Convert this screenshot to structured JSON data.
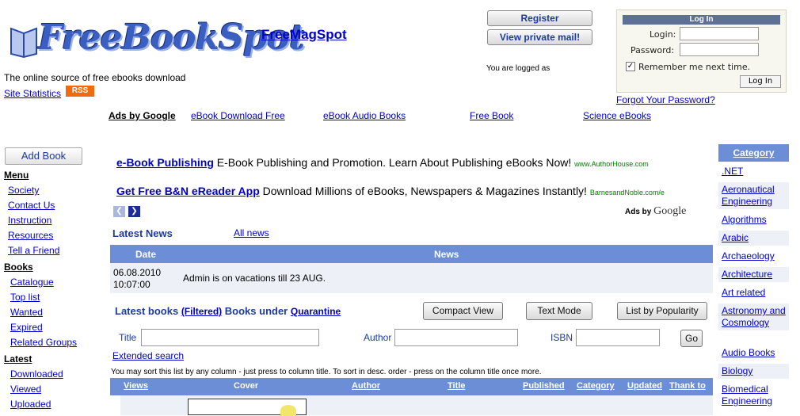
{
  "header": {
    "logo_text": "FreeBookSpot",
    "freemag": "FreeMagSpot",
    "tagline": "The online source of free ebooks download",
    "site_stats": "Site Statistics",
    "rss": "RSS",
    "register": "Register",
    "private_mail": "View private mail!",
    "logged_as": "You are logged as"
  },
  "login": {
    "title": "Log In",
    "login_label": "Login:",
    "password_label": "Password:",
    "remember": "Remember me next time.",
    "button": "Log In",
    "forgot": "Forgot Your Password?"
  },
  "ads_row": {
    "title": "Ads by Google",
    "links": [
      "eBook Download Free",
      "eBook Audio Books",
      "Free Book",
      "Science eBooks"
    ]
  },
  "left_menu": {
    "add_book": "Add Book",
    "menu_title": "Menu",
    "menu_items": [
      "Society",
      "Contact Us",
      "Instruction",
      "Resources",
      "Tell a Friend"
    ],
    "books_title": "Books",
    "books_items": [
      "Catalogue",
      "Top list",
      "Wanted",
      "Expired",
      "Related Groups"
    ],
    "latest_title": "Latest",
    "latest_items": [
      "Downloaded",
      "Viewed",
      "Uploaded"
    ]
  },
  "ads": [
    {
      "title": "e-Book Publishing",
      "text": "E-Book Publishing and Promotion. Learn About Publishing eBooks Now!",
      "source": "www.AuthorHouse.com"
    },
    {
      "title": "Get Free B&N eReader App",
      "text": "Download Millions of eBooks, Newspapers & Magazines Instantly!",
      "source": "BarnesandNoble.com/e"
    }
  ],
  "ads_by": "Ads by",
  "ads_google": "Google",
  "news": {
    "title": "Latest News",
    "all_link": "All news",
    "col_date": "Date",
    "col_news": "News",
    "date": "06.08.2010",
    "time": "10:07:00",
    "text": "Admin is on vacations till 23 AUG."
  },
  "books": {
    "title": "Latest books",
    "filtered": "(Filtered)",
    "under": "Books under",
    "quarantine": "Quarantine",
    "compact": "Compact View",
    "text_mode": "Text Mode",
    "popularity": "List by Popularity",
    "title_label": "Title",
    "author_label": "Author",
    "isbn_label": "ISBN",
    "go": "Go",
    "extended": "Extended search",
    "sort_hint": "You may sort this list by any column - just press to column title. To sort in desc. order - press on the column title once more.",
    "columns": [
      "Views",
      "Cover",
      "Author",
      "Title",
      "Published",
      "Category",
      "Updated",
      "Thank to"
    ]
  },
  "category": {
    "title": "Category",
    "items": [
      ".NET",
      "Aeronautical Engineering",
      "Algorithms",
      "Arabic",
      "Archaeology",
      "Architecture",
      "Art related",
      "Astronomy and Cosmology",
      "Audio Books",
      "Biology",
      "Biomedical Engineering"
    ]
  },
  "colors": {
    "accent": "#6b8ed7",
    "link": "#0000cc",
    "rss": "#f06a12"
  }
}
